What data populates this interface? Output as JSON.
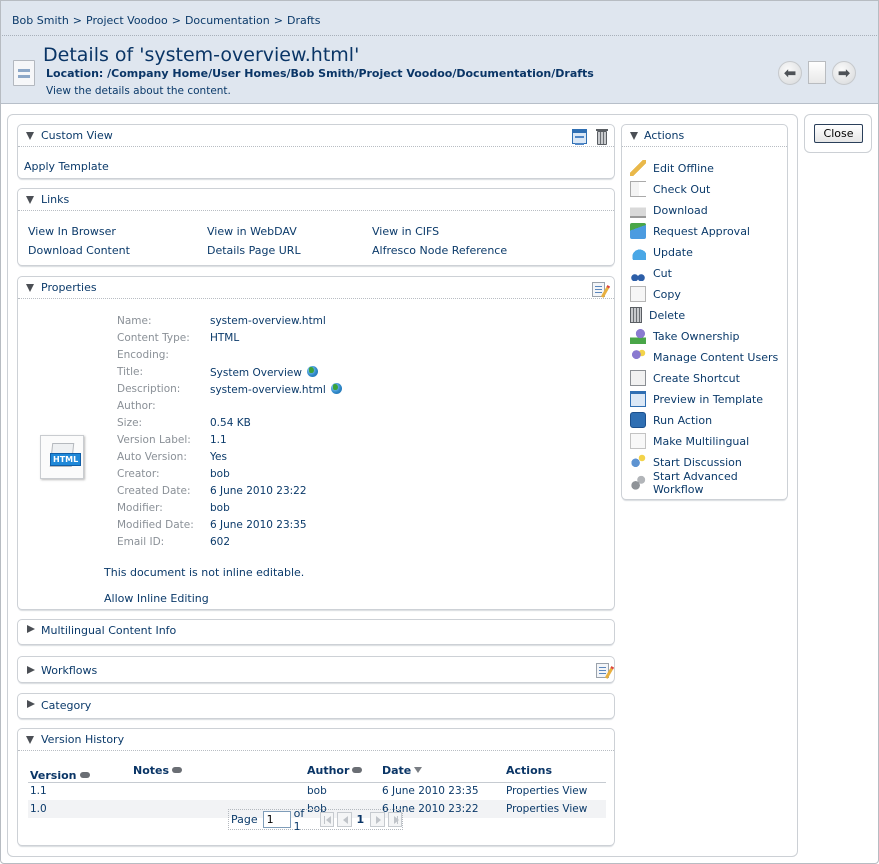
{
  "breadcrumb": [
    "Bob Smith",
    "Project Voodoo",
    "Documentation",
    "Drafts"
  ],
  "breadcrumb_separator": ">",
  "header": {
    "title": "Details of 'system-overview.html'",
    "location": "Location: /Company Home/User Homes/Bob Smith/Project Voodoo/Documentation/Drafts",
    "subtitle": "View the details about the content.",
    "nav_icons": [
      "previous-arrow-icon",
      "document-icon",
      "next-arrow-icon"
    ]
  },
  "close_label": "Close",
  "custom_view": {
    "title": "Custom View",
    "apply_template": "Apply Template",
    "icons": [
      "template-icon",
      "trash-icon"
    ]
  },
  "links": {
    "title": "Links",
    "items": [
      "View In Browser",
      "View in WebDAV",
      "View in CIFS",
      "Download Content",
      "Details Page URL",
      "Alfresco Node Reference"
    ]
  },
  "properties": {
    "title": "Properties",
    "file_icon_label": "HTML",
    "rows": [
      {
        "label": "Name:",
        "value": "system-overview.html",
        "multilingual": false
      },
      {
        "label": "Content Type:",
        "value": "HTML",
        "multilingual": false
      },
      {
        "label": "Encoding:",
        "value": "",
        "multilingual": false
      },
      {
        "label": "Title:",
        "value": "System Overview",
        "multilingual": true
      },
      {
        "label": "Description:",
        "value": "system-overview.html",
        "multilingual": true
      },
      {
        "label": "Author:",
        "value": "",
        "multilingual": false
      },
      {
        "label": "Size:",
        "value": "0.54 KB",
        "multilingual": false
      },
      {
        "label": "Version Label:",
        "value": "1.1",
        "multilingual": false
      },
      {
        "label": "Auto Version:",
        "value": "Yes",
        "multilingual": false
      },
      {
        "label": "Creator:",
        "value": "bob",
        "multilingual": false
      },
      {
        "label": "Created Date:",
        "value": "6 June 2010 23:22",
        "multilingual": false
      },
      {
        "label": "Modifier:",
        "value": "bob",
        "multilingual": false
      },
      {
        "label": "Modified Date:",
        "value": "6 June 2010 23:35",
        "multilingual": false
      },
      {
        "label": "Email ID:",
        "value": "602",
        "multilingual": false
      }
    ],
    "inline_note": "This document is not inline editable.",
    "allow_inline": "Allow Inline Editing"
  },
  "collapsed_panels": [
    {
      "title": "Multilingual Content Info",
      "has_edit_icon": false
    },
    {
      "title": "Workflows",
      "has_edit_icon": true
    },
    {
      "title": "Category",
      "has_edit_icon": false
    }
  ],
  "version_history": {
    "title": "Version History",
    "columns": [
      {
        "label": "Version",
        "sort": "none"
      },
      {
        "label": "Notes",
        "sort": "none"
      },
      {
        "label": "Author",
        "sort": "none"
      },
      {
        "label": "Date",
        "sort": "descending"
      },
      {
        "label": "Actions",
        "sort": ""
      }
    ],
    "rows": [
      {
        "version": "1.1",
        "notes": "",
        "author": "bob",
        "date": "6 June 2010 23:35",
        "actions": "Properties View"
      },
      {
        "version": "1.0",
        "notes": "",
        "author": "bob",
        "date": "6 June 2010 23:22",
        "actions": "Properties View"
      }
    ],
    "pager": {
      "page_label": "Page",
      "page_value": "1",
      "of_label": "of 1",
      "current": "1"
    }
  },
  "actions": {
    "title": "Actions",
    "items": [
      {
        "label": "Edit Offline",
        "icon": "pencil-icon"
      },
      {
        "label": "Check Out",
        "icon": "check-out-icon"
      },
      {
        "label": "Download",
        "icon": "download-icon"
      },
      {
        "label": "Request Approval",
        "icon": "request-approval-icon"
      },
      {
        "label": "Update",
        "icon": "update-icon"
      },
      {
        "label": "Cut",
        "icon": "scissors-icon"
      },
      {
        "label": "Copy",
        "icon": "copy-icon"
      },
      {
        "label": "Delete",
        "icon": "trash-icon"
      },
      {
        "label": "Take Ownership",
        "icon": "take-ownership-icon"
      },
      {
        "label": "Manage Content Users",
        "icon": "users-icon"
      },
      {
        "label": "Create Shortcut",
        "icon": "shortcut-icon"
      },
      {
        "label": "Preview in Template",
        "icon": "template-icon"
      },
      {
        "label": "Run Action",
        "icon": "run-action-icon"
      },
      {
        "label": "Make Multilingual",
        "icon": "multilingual-icon"
      },
      {
        "label": "Start Discussion",
        "icon": "discussion-icon"
      },
      {
        "label": "Start Advanced Workflow",
        "icon": "workflow-gears-icon"
      }
    ]
  }
}
